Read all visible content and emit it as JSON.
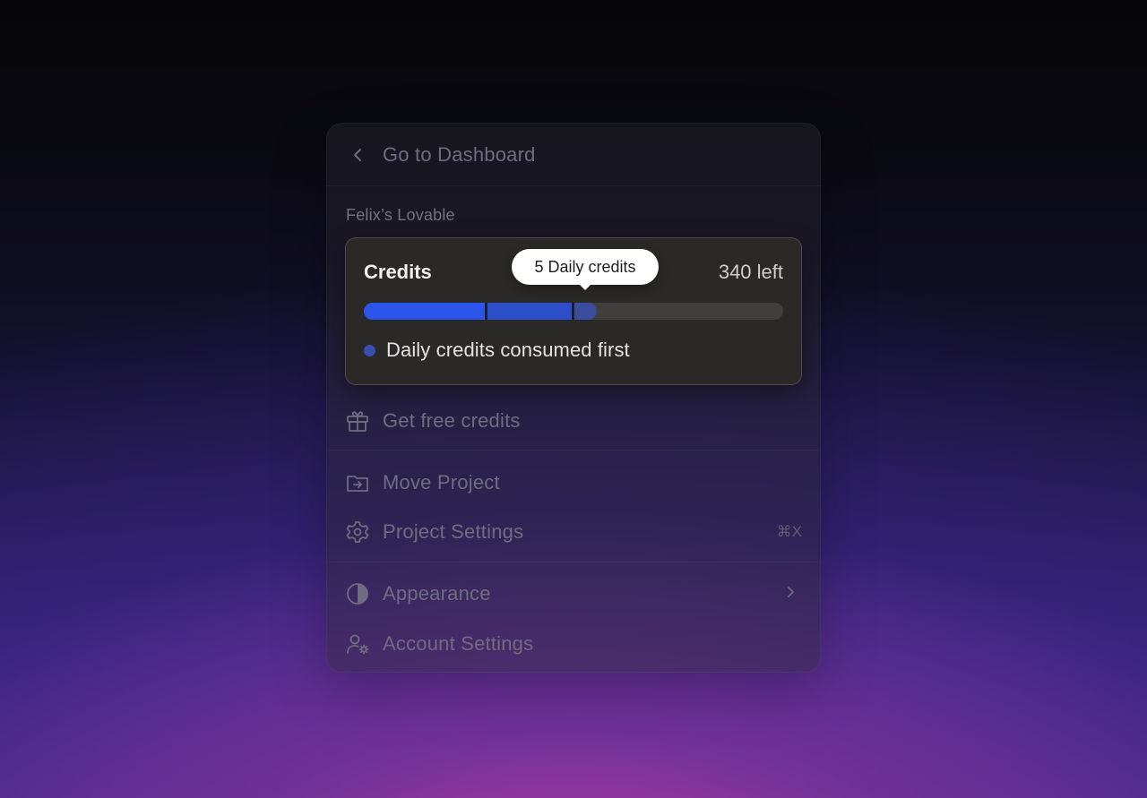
{
  "menu": {
    "back": {
      "icon": "chevron-left-icon",
      "label": "Go to Dashboard"
    },
    "workspace_name": "Felix’s Lovable",
    "credits": {
      "title": "Credits",
      "remaining": "340 left",
      "tooltip": "5 Daily credits",
      "legend": "Daily credits consumed first",
      "progress": {
        "segment_1": 0.29,
        "segment_2": 0.2,
        "segment_3": 0.06
      },
      "colors": {
        "segment_1": "#2b54ea",
        "segment_2": "#2c4ec8",
        "segment_3": "#3a4c9c",
        "track": "#403f3e",
        "legend_dot": "#3a4eb0"
      }
    },
    "items": [
      {
        "icon": "gift-icon",
        "label": "Get free credits"
      },
      {
        "icon": "folder-move-icon",
        "label": "Move Project"
      },
      {
        "icon": "gear-icon",
        "label": "Project Settings",
        "shortcut": "⌘X"
      },
      {
        "icon": "half-circle-icon",
        "label": "Appearance",
        "trailing_icon": "chevron-right-icon"
      },
      {
        "icon": "user-settings-icon",
        "label": "Account Settings"
      }
    ]
  }
}
